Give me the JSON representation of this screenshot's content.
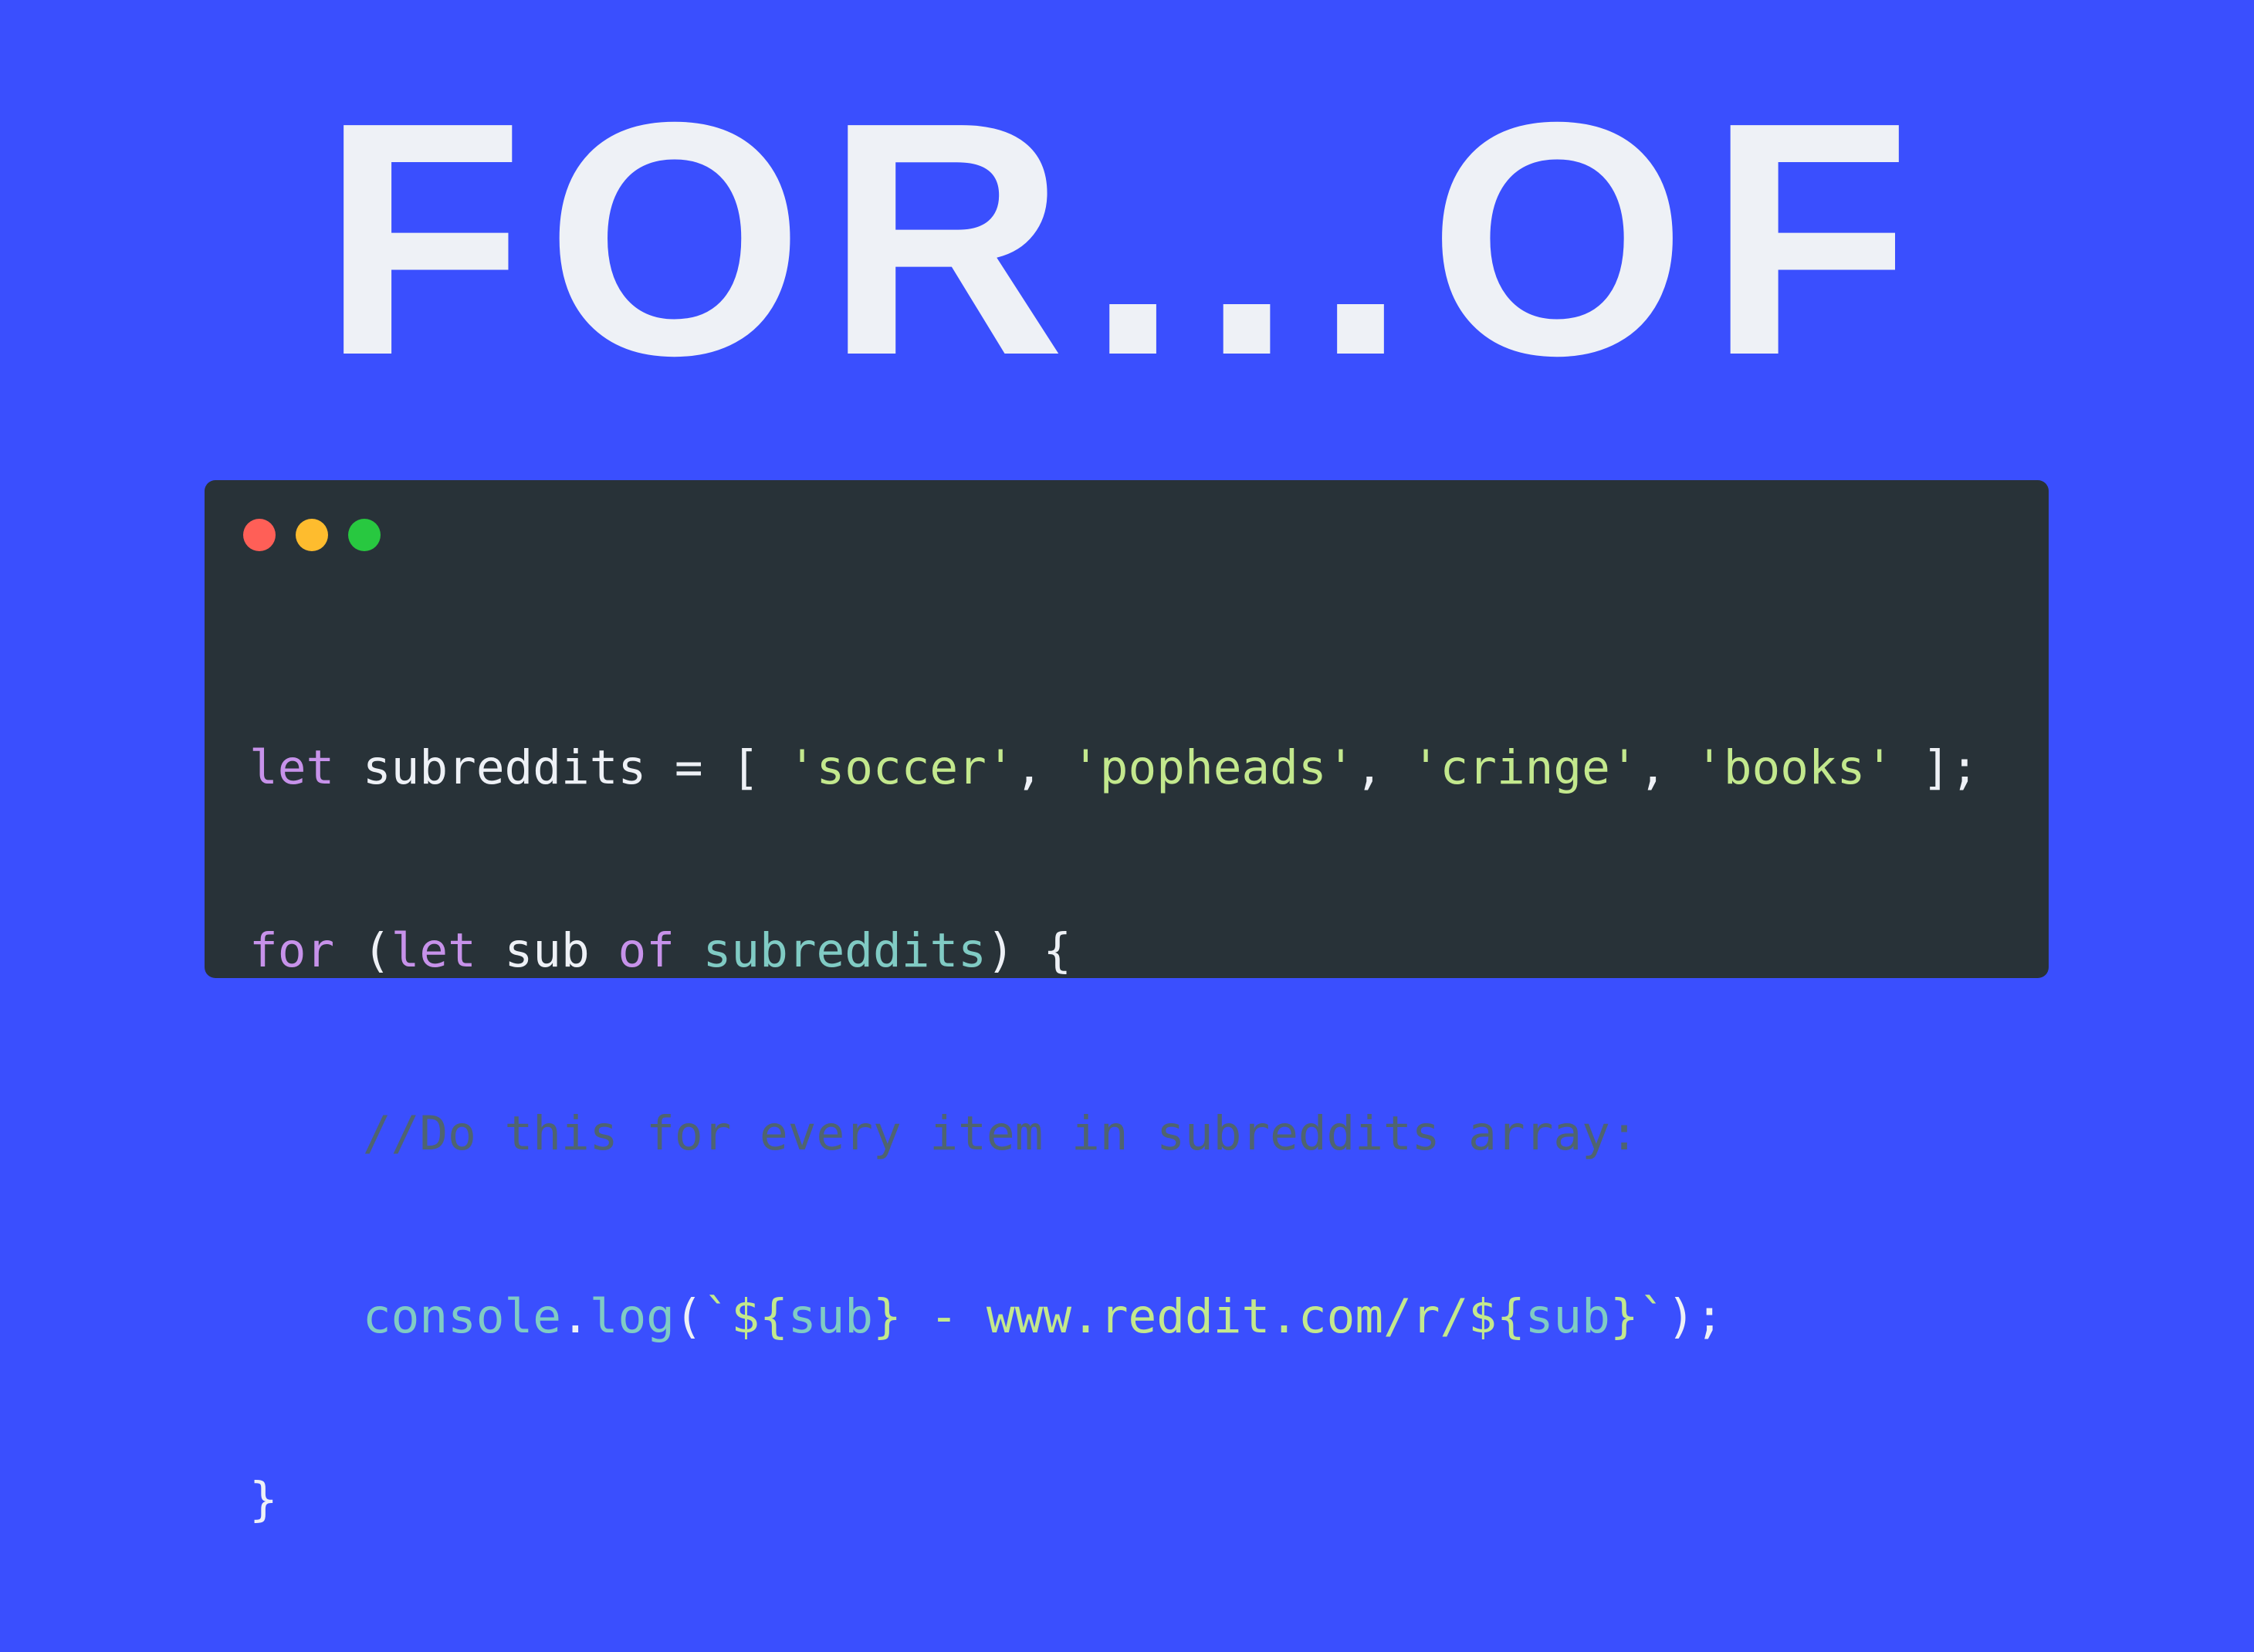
{
  "title": "FOR...OF",
  "window_dots": [
    "close-dot",
    "minimize-dot",
    "maximize-dot"
  ],
  "colors": {
    "background": "#3a4ffe",
    "editor_background": "#283238",
    "keyword": "#c792ea",
    "string": "#c3e88d",
    "identifier": "#80cbc4",
    "comment": "#4f6470",
    "text": "#eef1f6"
  },
  "code": {
    "line1": {
      "kw_let": "let",
      "var_decl": " subreddits = [ ",
      "s1": "'soccer'",
      "c1": ", ",
      "s2": "'popheads'",
      "c2": ", ",
      "s3": "'cringe'",
      "c3": ", ",
      "s4": "'books'",
      "end": " ];"
    },
    "line2": {
      "kw_for": "for",
      "p_open": " (",
      "kw_let": "let",
      "var_sub": " sub ",
      "kw_of": "of",
      "sp": " ",
      "id_arr": "subreddits",
      "p_close": ") {"
    },
    "line3": {
      "indent": "    ",
      "comment": "//Do this for every item in subreddits array:"
    },
    "line4": {
      "indent": "    ",
      "id_console": "console",
      "dot": ".",
      "id_log": "log",
      "paren": "(",
      "tpl_start": "`${",
      "id_sub1": "sub",
      "tpl_mid": "} - www.reddit.com/r/${",
      "id_sub2": "sub",
      "tpl_end": "}`",
      "end": ");"
    },
    "line5": {
      "brace": "}"
    }
  }
}
